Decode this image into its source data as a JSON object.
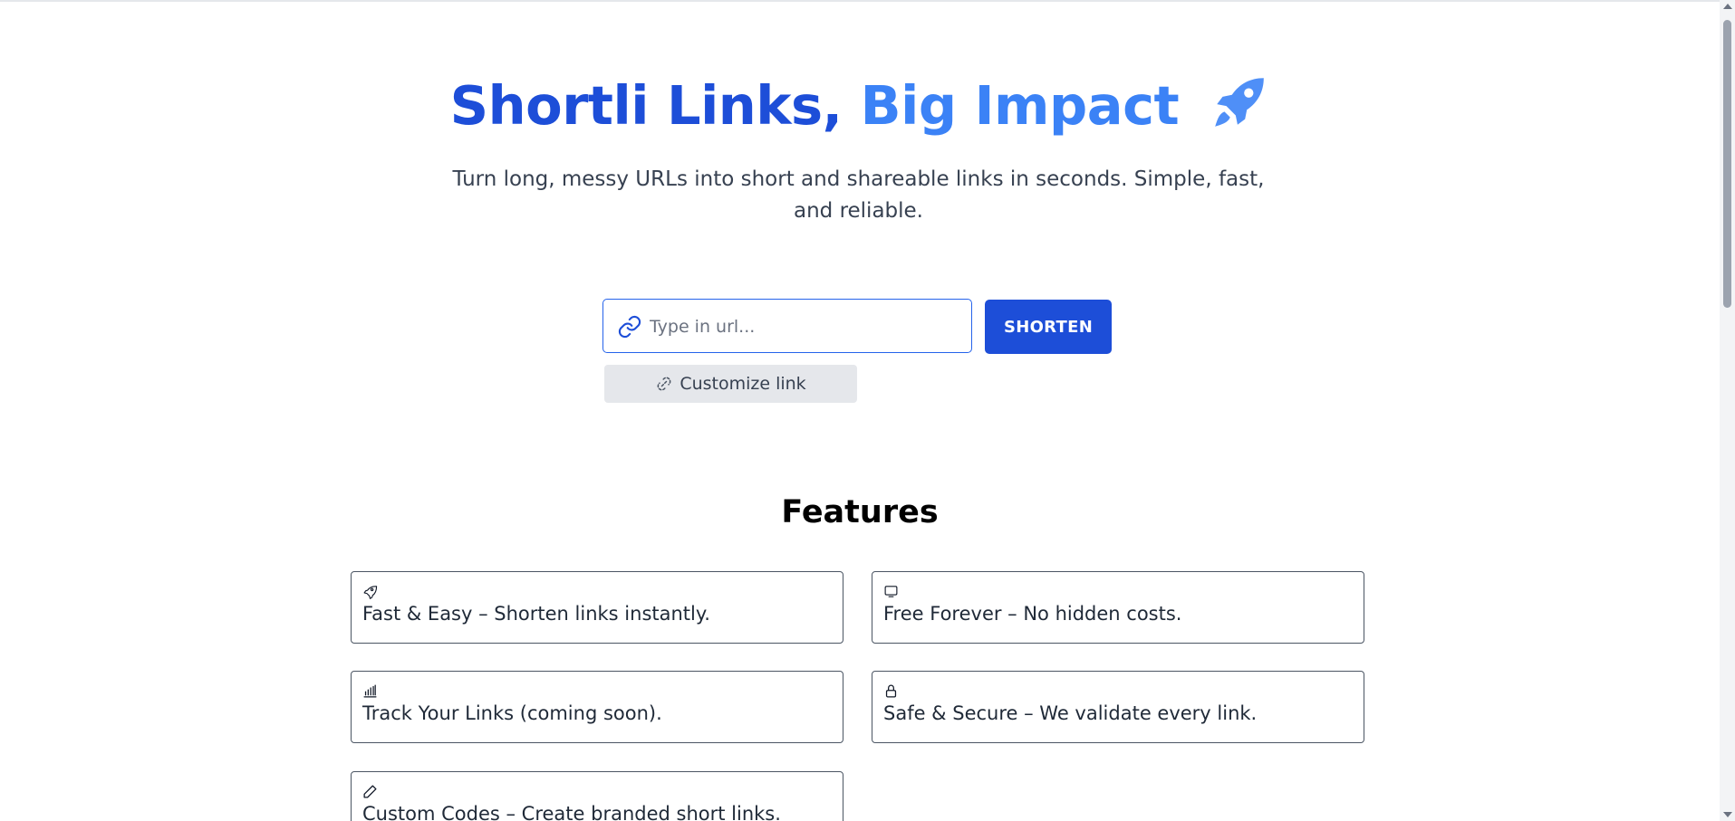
{
  "hero": {
    "title_part1": "Shortli Links,",
    "title_part2": "Big Impact",
    "title_icon": "rocket-icon",
    "subtitle": "Turn long, messy URLs into short and shareable links in seconds. Simple, fast, and reliable."
  },
  "shortener": {
    "input_icon": "link-icon",
    "url_value": "",
    "url_placeholder": "Type in url...",
    "shorten_label": "SHORTEN",
    "customize_icon": "dashed-link-icon",
    "customize_label": "Customize link"
  },
  "features": {
    "title": "Features",
    "items": [
      {
        "icon": "rocket-icon",
        "text": "Fast & Easy – Shorten links instantly."
      },
      {
        "icon": "monitor-icon",
        "text": "Free Forever – No hidden costs."
      },
      {
        "icon": "bar-chart-icon",
        "text": "Track Your Links (coming soon)."
      },
      {
        "icon": "lock-icon",
        "text": "Safe & Secure – We validate every link."
      },
      {
        "icon": "pencil-icon",
        "text": "Custom Codes – Create branded short links."
      }
    ]
  },
  "colors": {
    "primary": "#1d4ed8",
    "title_gradient_end": "#3b82f6",
    "rocket": "#4f8ff7",
    "text": "#374151",
    "card_border": "#4b5563",
    "customize_bg": "#e5e7eb"
  }
}
